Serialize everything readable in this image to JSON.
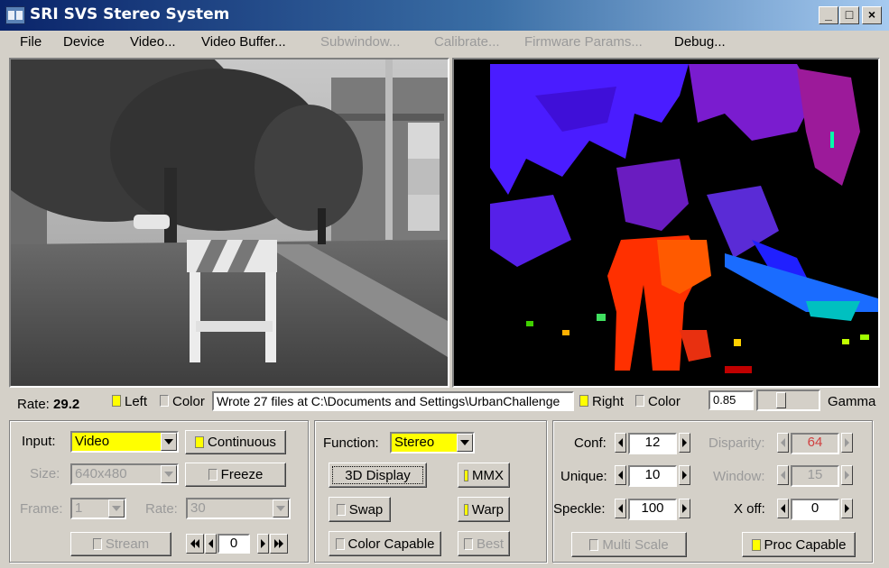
{
  "window": {
    "title": "SRI SVS Stereo System",
    "minimize_label": "_",
    "maximize_label": "□",
    "close_label": "×"
  },
  "menu": {
    "file": "File",
    "device": "Device",
    "video": "Video...",
    "video_buffer": "Video Buffer...",
    "subwindow": "Subwindow...",
    "calibrate": "Calibrate...",
    "firmware_params": "Firmware Params...",
    "debug": "Debug..."
  },
  "status": {
    "rate_label": "Rate:",
    "rate_value": "29.2",
    "left_label": "Left",
    "left_checked": true,
    "left_color_label": "Color",
    "left_color_checked": false,
    "message": "Wrote 27 files at C:\\Documents and Settings\\UrbanChallenge",
    "right_label": "Right",
    "right_checked": true,
    "right_color_label": "Color",
    "right_color_checked": false,
    "gamma_value": "0.85",
    "gamma_label": "Gamma",
    "gamma_level": 0.35
  },
  "input_panel": {
    "input_label": "Input:",
    "input_value": "Video",
    "continuous_label": "Continuous",
    "continuous_checked": true,
    "size_label": "Size:",
    "size_value": "640x480",
    "freeze_label": "Freeze",
    "freeze_checked": false,
    "frame_label": "Frame:",
    "frame_value": "1",
    "rate_label": "Rate:",
    "rate_value": "30",
    "stream_label": "Stream",
    "stream_checked": false,
    "frame_counter": "0"
  },
  "function_panel": {
    "function_label": "Function:",
    "function_value": "Stereo",
    "display_3d_label": "3D Display",
    "mmx_label": "MMX",
    "mmx_checked": true,
    "swap_label": "Swap",
    "swap_checked": false,
    "warp_label": "Warp",
    "warp_checked": true,
    "color_capable_label": "Color Capable",
    "color_capable_checked": false,
    "best_label": "Best",
    "best_checked": false
  },
  "params_panel": {
    "conf_label": "Conf:",
    "conf_value": "12",
    "disparity_label": "Disparity:",
    "disparity_value": "64",
    "unique_label": "Unique:",
    "unique_value": "10",
    "window_label": "Window:",
    "window_value": "15",
    "speckle_label": "Speckle:",
    "speckle_value": "100",
    "xoff_label": "X off:",
    "xoff_value": "0",
    "multiscale_label": "Multi Scale",
    "multiscale_checked": false,
    "proc_capable_label": "Proc Capable",
    "proc_capable_checked": true
  },
  "colors": {
    "checked_yellow": "#ffff00",
    "title_bar_start": "#0a246a",
    "title_bar_end": "#a6caf0",
    "disparity_near": "#ff3000",
    "disparity_far": "#4000ff"
  }
}
